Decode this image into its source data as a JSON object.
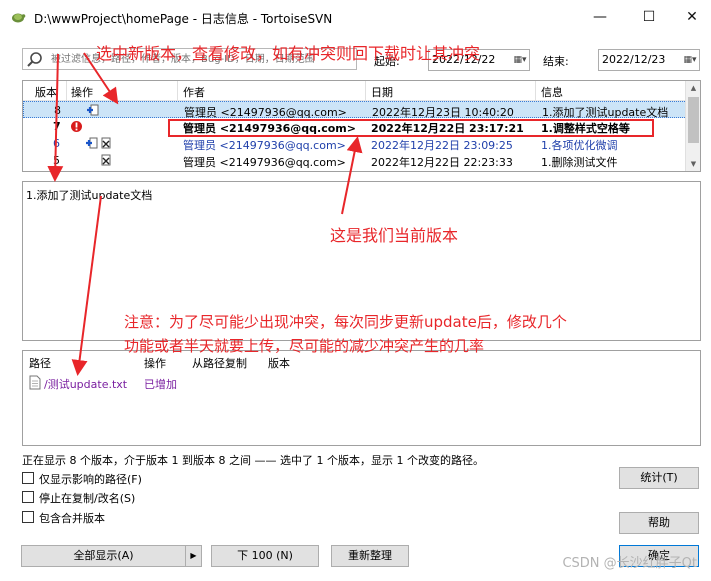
{
  "window": {
    "title": "D:\\wwwProject\\homePage - 日志信息 - TortoiseSVN",
    "minimize": "—",
    "maximize": "☐",
    "close": "✕"
  },
  "filter": {
    "search_placeholder": "被过滤信息，路径，作者，版本，Bug-ID，日期，日期范围",
    "from_label": "起始:",
    "from_date": "2022/12/22",
    "to_label": "结束:",
    "to_date": "2022/12/23"
  },
  "revisions": {
    "columns": [
      "版本",
      "操作",
      "作者",
      "日期",
      "信息"
    ],
    "rows": [
      {
        "rev": "8",
        "author": "管理员 <21497936@qq.com>",
        "date": "2022年12月23日 10:40:20",
        "message": "1.添加了测试update文档"
      },
      {
        "rev": "7",
        "author": "管理员 <21497936@qq.com>",
        "date": "2022年12月22日 23:17:21",
        "message": "1.调整样式空格等"
      },
      {
        "rev": "6",
        "author": "管理员 <21497936@qq.com>",
        "date": "2022年12月22日 23:09:25",
        "message": "1.各项优化微调"
      },
      {
        "rev": "5",
        "author": "管理员 <21497936@qq.com>",
        "date": "2022年12月22日 22:23:33",
        "message": "1.删除测试文件"
      }
    ]
  },
  "message_pane": {
    "text": "1.添加了测试update文档"
  },
  "paths": {
    "columns": [
      "路径",
      "操作",
      "从路径复制",
      "版本"
    ],
    "rows": [
      {
        "path": "/测试update.txt",
        "action": "已增加"
      }
    ]
  },
  "status": "正在显示 8 个版本，介于版本 1 到版本 8 之间 —— 选中了 1 个版本，显示 1 个改变的路径。",
  "options": {
    "only_affected": "仅显示影响的路径(F)",
    "stop_on_copy": "停止在复制/改名(S)",
    "include_merged": "包含合并版本"
  },
  "buttons": {
    "show_all": "全部显示(A)",
    "next_100": "下 100 (N)",
    "refresh": "重新整理",
    "statistics": "统计(T)",
    "help": "帮助",
    "ok": "确定"
  },
  "annotations": {
    "top": "选中新版本，查看修改，如有冲突则回下载时让其冲突",
    "current": "这是我们当前版本",
    "note_line1": "注意：为了尽可能少出现冲突，每次同步更新update后，修改几个",
    "note_line2": "功能或者半天就要上传，尽可能的减少冲突产生的几率"
  },
  "watermark": "CSDN @长沙红胖子Qt",
  "colors": {
    "annotation": "#e8262a",
    "selected_row": "#cce4f7",
    "link_blue": "#1f3faa",
    "path_purple": "#7a1fa0"
  }
}
